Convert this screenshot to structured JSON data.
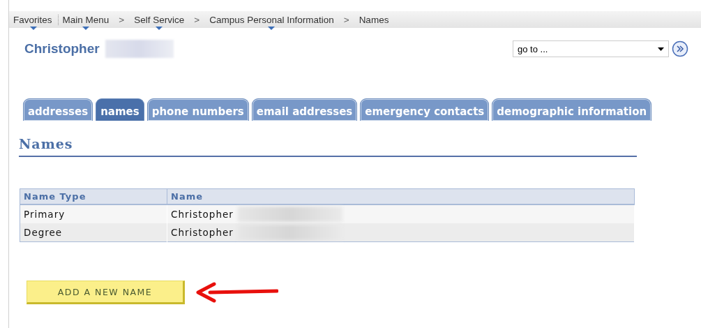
{
  "breadcrumb": [
    {
      "kind": "item",
      "label": "Favorites",
      "dropdown": true
    },
    {
      "kind": "item",
      "label": "Main Menu",
      "dropdown": true
    },
    {
      "kind": "separator",
      "label": ">"
    },
    {
      "kind": "item",
      "label": "Self Service",
      "dropdown": true
    },
    {
      "kind": "separator",
      "label": ">"
    },
    {
      "kind": "item",
      "label": "Campus Personal Information",
      "dropdown": true
    },
    {
      "kind": "separator",
      "label": ">"
    },
    {
      "kind": "item",
      "label": "Names",
      "dropdown": false
    }
  ],
  "person": {
    "first_name": "Christopher"
  },
  "goto": {
    "value": "go to ..."
  },
  "tabs": [
    {
      "label": "addresses",
      "selected": false
    },
    {
      "label": "names",
      "selected": true
    },
    {
      "label": "phone numbers",
      "selected": false
    },
    {
      "label": "email addresses",
      "selected": false
    },
    {
      "label": "emergency contacts",
      "selected": false
    },
    {
      "label": "demographic information",
      "selected": false
    }
  ],
  "section_title": "Names",
  "table": {
    "columns": [
      "Name Type",
      "Name"
    ],
    "rows": [
      [
        "Primary",
        "Christopher"
      ],
      [
        "Degree",
        "Christopher"
      ]
    ]
  },
  "add_button": "ADD A NEW NAME"
}
